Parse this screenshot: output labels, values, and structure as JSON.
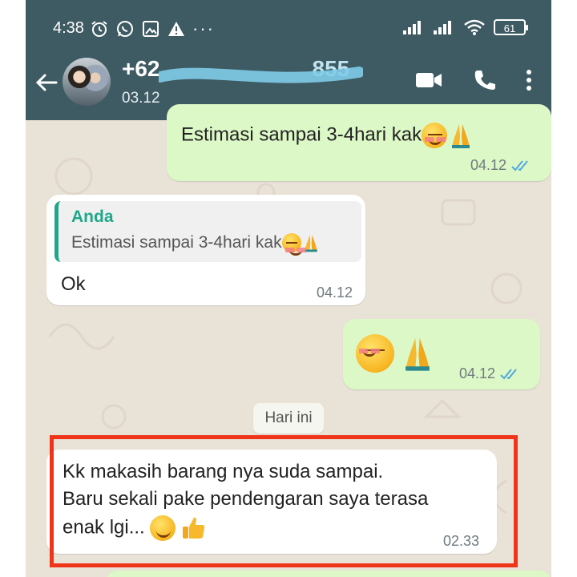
{
  "status_bar": {
    "time": "4:38",
    "battery": "61"
  },
  "header": {
    "contact_name": "+62",
    "contact_name_obscured_tail": "855",
    "subtitle": "03.12"
  },
  "messages": [
    {
      "direction": "outgoing",
      "text": "Estimasi sampai 3-4hari kak",
      "emoji": [
        "smiling-face",
        "folded-hands"
      ],
      "time": "04.12",
      "read": true
    },
    {
      "direction": "incoming",
      "quoted_author": "Anda",
      "quoted_text": "Estimasi sampai 3-4hari kak",
      "text": "Ok",
      "time": "04.12"
    },
    {
      "direction": "outgoing",
      "text": "",
      "emoji": [
        "smiling-face",
        "folded-hands"
      ],
      "time": "04.12",
      "read": true
    },
    {
      "direction": "incoming",
      "lines": [
        "Kk makasih barang nya suda sampai.",
        "Baru sekali pake pendengaran saya terasa",
        "enak lgi..."
      ],
      "emoji": [
        "slightly-smiling-face",
        "thumbs-up"
      ],
      "time": "02.33"
    }
  ],
  "day_divider": "Hari ini",
  "colors": {
    "app_bar": "#3e5a63",
    "outgoing_bubble": "#dcf8c6",
    "incoming_bubble": "#ffffff",
    "chat_background": "#e9e2d7",
    "accent_green": "#1fa78a",
    "read_ticks": "#4fa8e0",
    "highlight_box": "#f0341a"
  },
  "icons": [
    "back-arrow-icon",
    "video-call-icon",
    "voice-call-icon",
    "more-options-icon",
    "alarm-icon",
    "whatsapp-icon",
    "gallery-icon",
    "warning-icon",
    "signal-icon",
    "wifi-icon",
    "battery-icon"
  ]
}
